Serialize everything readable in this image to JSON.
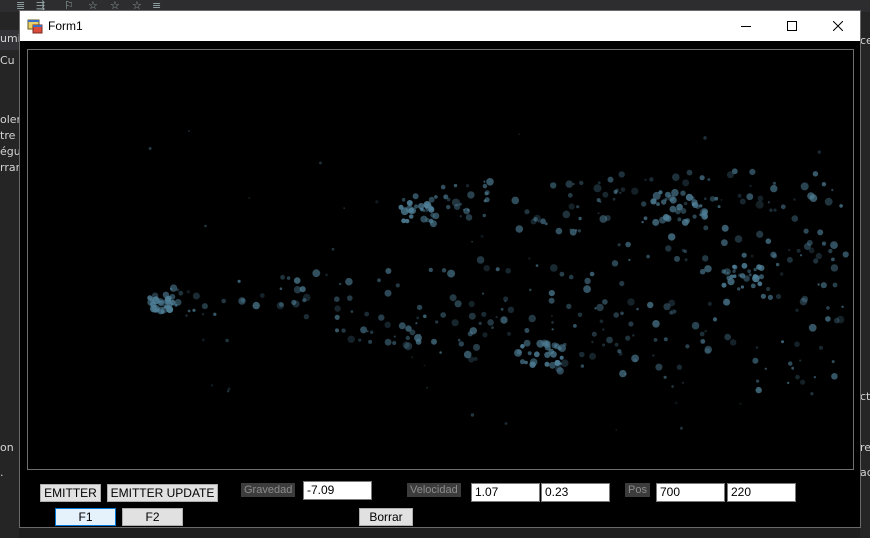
{
  "window": {
    "title": "Form1"
  },
  "background": {
    "left_texts": [
      "umi",
      "Cu",
      "oler",
      "tre u",
      "égu",
      "rrar",
      "on",
      "."
    ],
    "right_texts": [
      "ce",
      "ct",
      "re",
      "ac"
    ]
  },
  "controls": {
    "emitter_label": "EMITTER",
    "emitter_update_label": "EMITTER UPDATE",
    "f1_label": "F1",
    "f2_label": "F2",
    "borrar_label": "Borrar",
    "gravedad_label": "Gravedad",
    "gravedad_value": "-7.09",
    "velocidad_label": "Velocidad",
    "velocidad_x": "1.07",
    "velocidad_y": "0.23",
    "pos_label": "Pos",
    "pos_x": "700",
    "pos_y": "220"
  },
  "colors": {
    "particle": "#4f7f97",
    "canvas": "#000000",
    "titlebar": "#ffffff"
  },
  "icons": [
    "app-form-icon",
    "minimize-icon",
    "maximize-icon",
    "close-icon"
  ]
}
